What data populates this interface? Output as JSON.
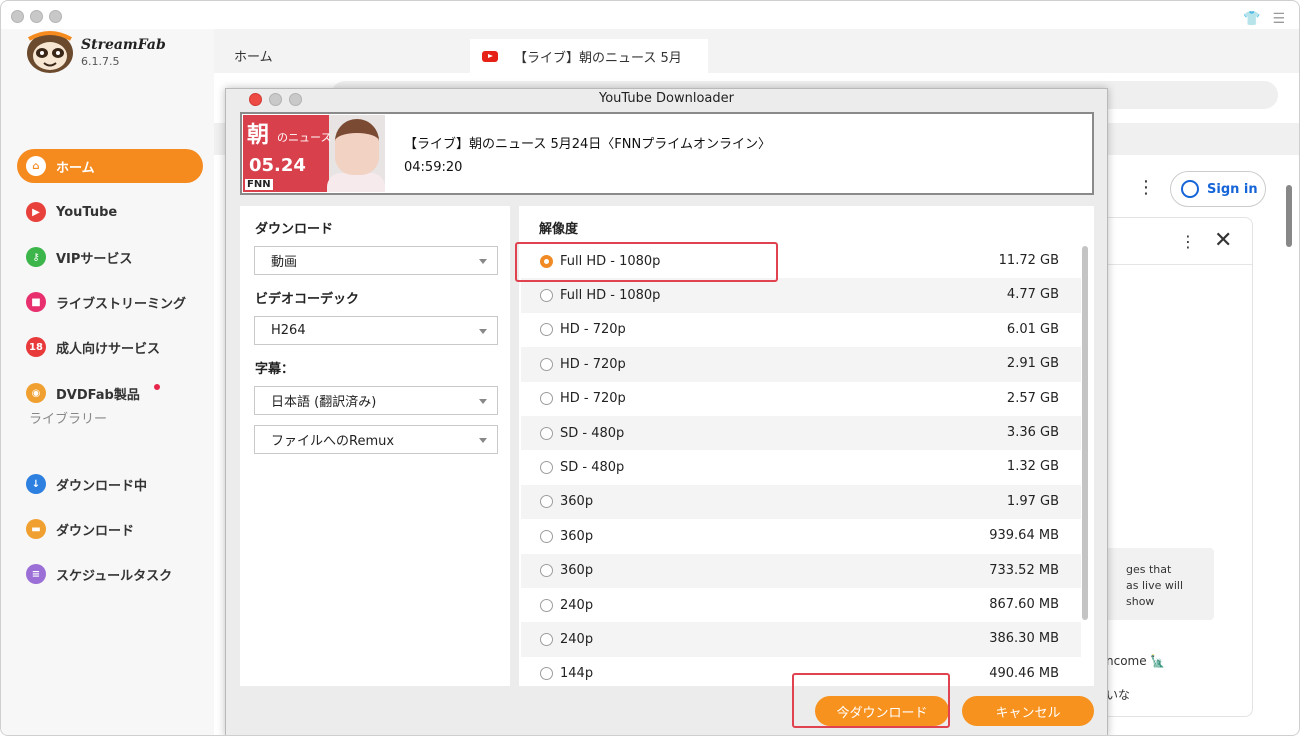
{
  "app": {
    "brand": "StreamFab",
    "version": "6.1.7.5"
  },
  "sidebar": {
    "items": [
      {
        "label": "ホーム",
        "icon": "home-icon",
        "color": "#f58a1f"
      },
      {
        "label": "YouTube",
        "icon": "youtube-icon",
        "color": "#e8403a"
      },
      {
        "label": "VIPサービス",
        "icon": "key-icon",
        "color": "#3cb54a"
      },
      {
        "label": "ライブストリーミング",
        "icon": "camera-icon",
        "color": "#e8306e"
      },
      {
        "label": "成人向けサービス",
        "icon": "adult-18-icon",
        "color": "#e83a3a"
      },
      {
        "label": "DVDFab製品",
        "icon": "dvdfab-icon",
        "color": "#f0a030"
      }
    ],
    "library_label": "ライブラリー",
    "library_items": [
      {
        "label": "ダウンロード中",
        "icon": "download-arrow-icon",
        "color": "#2d7fe0"
      },
      {
        "label": "ダウンロード",
        "icon": "folder-icon",
        "color": "#f0a030"
      },
      {
        "label": "スケジュールタスク",
        "icon": "schedule-list-icon",
        "color": "#9b6fd6"
      }
    ]
  },
  "browser": {
    "tab_home": "ホーム",
    "tab_live": "【ライブ】朝のニュース 5月",
    "signin": "Sign in",
    "chat_note": "ges that\nas live will show",
    "chat_msg1": "ncome 🗽",
    "chat_msg2": "いな"
  },
  "dialog": {
    "title": "YouTube Downloader",
    "video": {
      "title": "【ライブ】朝のニュース 5月24日〈FNNプライムオンライン〉",
      "duration": "04:59:20",
      "thumb_text": "朝",
      "thumb_text2": "のニュース",
      "thumb_date": "05.24",
      "thumb_fnn": "FNN"
    },
    "download_label": "ダウンロード",
    "download_value": "動画",
    "codec_label": "ビデオコーデック",
    "codec_value": "H264",
    "subtitle_label": "字幕：",
    "subtitle_value": "日本語 (翻訳済み)",
    "remux_value": "ファイルへのRemux",
    "resolution_label": "解像度",
    "resolutions": [
      {
        "label": "Full HD - 1080p",
        "size": "11.72 GB",
        "selected": true
      },
      {
        "label": "Full HD - 1080p",
        "size": "4.77 GB",
        "selected": false
      },
      {
        "label": "HD - 720p",
        "size": "6.01 GB",
        "selected": false
      },
      {
        "label": "HD - 720p",
        "size": "2.91 GB",
        "selected": false
      },
      {
        "label": "HD - 720p",
        "size": "2.57 GB",
        "selected": false
      },
      {
        "label": "SD - 480p",
        "size": "3.36 GB",
        "selected": false
      },
      {
        "label": "SD - 480p",
        "size": "1.32 GB",
        "selected": false
      },
      {
        "label": "360p",
        "size": "1.97 GB",
        "selected": false
      },
      {
        "label": "360p",
        "size": "939.64 MB",
        "selected": false
      },
      {
        "label": "360p",
        "size": "733.52 MB",
        "selected": false
      },
      {
        "label": "240p",
        "size": "867.60 MB",
        "selected": false
      },
      {
        "label": "240p",
        "size": "386.30 MB",
        "selected": false
      },
      {
        "label": "144p",
        "size": "490.46 MB",
        "selected": false
      }
    ],
    "download_now": "今ダウンロード",
    "cancel": "キャンセル"
  },
  "colors": {
    "accent": "#f58a1f",
    "highlight": "#e0434f"
  }
}
